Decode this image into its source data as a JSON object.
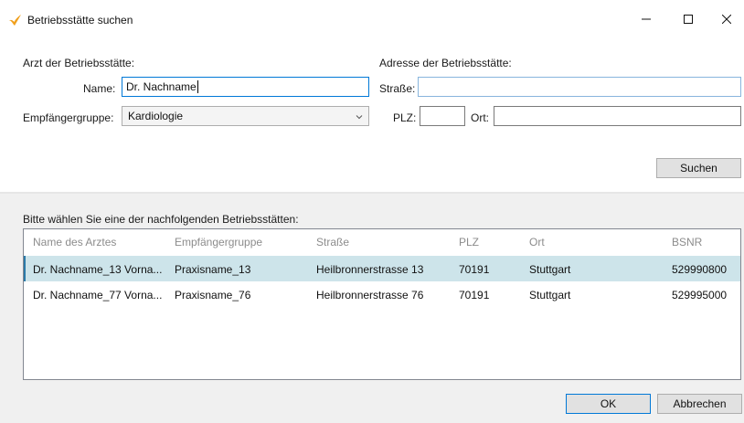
{
  "window": {
    "title": "Betriebsstätte suchen",
    "controls": {
      "minimize": "minimize-icon",
      "maximize": "maximize-icon",
      "close": "close-icon"
    }
  },
  "search": {
    "doctor_heading": "Arzt der Betriebsstätte:",
    "address_heading": "Adresse der Betriebsstätte:",
    "name_label": "Name:",
    "name_value": "Dr. Nachname",
    "group_label": "Empfängergruppe:",
    "group_value": "Kardiologie",
    "street_label": "Straße:",
    "street_value": "",
    "plz_label": "PLZ:",
    "plz_value": "",
    "ort_label": "Ort:",
    "ort_value": "",
    "search_button": "Suchen"
  },
  "results": {
    "prompt": "Bitte wählen Sie eine der nachfolgenden Betriebsstätten:",
    "columns": [
      "Name des Arztes",
      "Empfängergruppe",
      "Straße",
      "PLZ",
      "Ort",
      "BSNR"
    ],
    "rows": [
      {
        "cells": [
          "Dr. Nachname_13 Vorna...",
          "Praxisname_13",
          "Heilbronnerstrasse 13",
          "70191",
          "Stuttgart",
          "529990800"
        ],
        "selected": true
      },
      {
        "cells": [
          "Dr. Nachname_77 Vorna...",
          "Praxisname_76",
          "Heilbronnerstrasse 76",
          "70191",
          "Stuttgart",
          "529995000"
        ],
        "selected": false
      }
    ]
  },
  "footer": {
    "ok_button": "OK",
    "cancel_button": "Abbrechen"
  },
  "colors": {
    "accent": "#0078d7",
    "selection": "#cde4ea",
    "dialog_background": "#f0f0f0"
  },
  "icons": {
    "app": "app-logo-icon",
    "dropdown": "chevron-down-icon"
  }
}
